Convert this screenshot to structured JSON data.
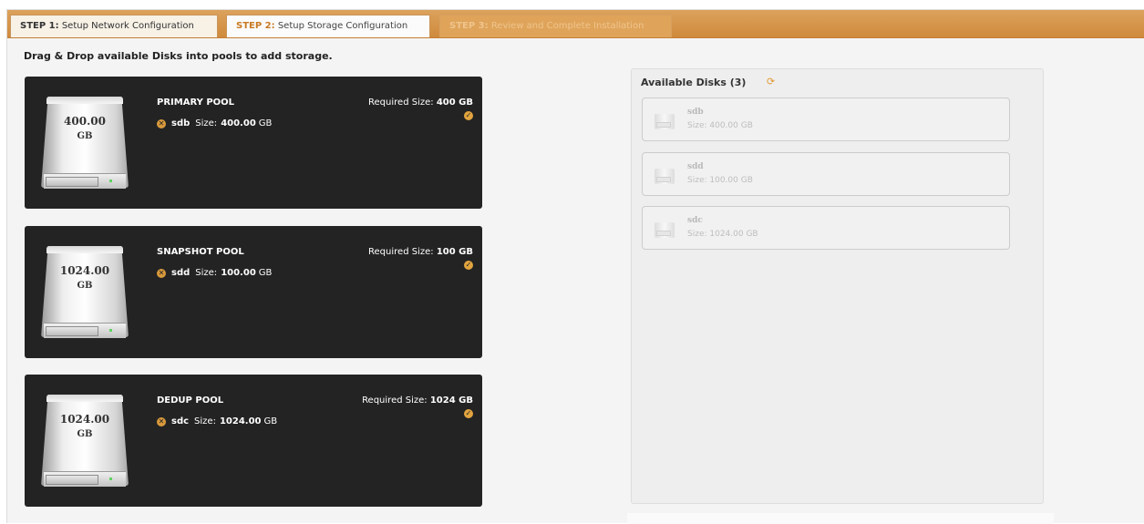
{
  "tabs": [
    {
      "step": "STEP 1:",
      "label": "Setup Network Configuration",
      "state": "completed"
    },
    {
      "step": "STEP 2:",
      "label": "Setup Storage Configuration",
      "state": "active"
    },
    {
      "step": "STEP 3:",
      "label": "Review and Complete Installation",
      "state": "disabled"
    }
  ],
  "instruction": "Drag & Drop available Disks into pools to add storage.",
  "pools": [
    {
      "name": "PRIMARY POOL",
      "required_label": "Required Size:",
      "required_value": "400 GB",
      "disk_size": "400.00",
      "disk_unit": "GB",
      "assigned": {
        "disk": "sdb",
        "size_label": "Size:",
        "size_value": "400.00",
        "size_unit": "GB"
      }
    },
    {
      "name": "SNAPSHOT POOL",
      "required_label": "Required Size:",
      "required_value": "100 GB",
      "disk_size": "1024.00",
      "disk_unit": "GB",
      "assigned": {
        "disk": "sdd",
        "size_label": "Size:",
        "size_value": "100.00",
        "size_unit": "GB"
      }
    },
    {
      "name": "DEDUP POOL",
      "required_label": "Required Size:",
      "required_value": "1024 GB",
      "disk_size": "1024.00",
      "disk_unit": "GB",
      "assigned": {
        "disk": "sdc",
        "size_label": "Size:",
        "size_value": "1024.00",
        "size_unit": "GB"
      }
    }
  ],
  "available": {
    "title": "Available Disks (3)",
    "disks": [
      {
        "name": "sdb",
        "size": "Size: 400.00 GB"
      },
      {
        "name": "sdd",
        "size": "Size: 100.00 GB"
      },
      {
        "name": "sdc",
        "size": "Size: 1024.00 GB"
      }
    ]
  },
  "colors": {
    "tabbar": "#d4923f",
    "pool_bg": "#232323",
    "accent": "#e1a43f",
    "active_step": "#c97a24"
  },
  "icons": {
    "remove": "remove-disk-icon",
    "check": "check-icon",
    "refresh": "refresh-icon",
    "disk": "hard-disk-icon"
  }
}
